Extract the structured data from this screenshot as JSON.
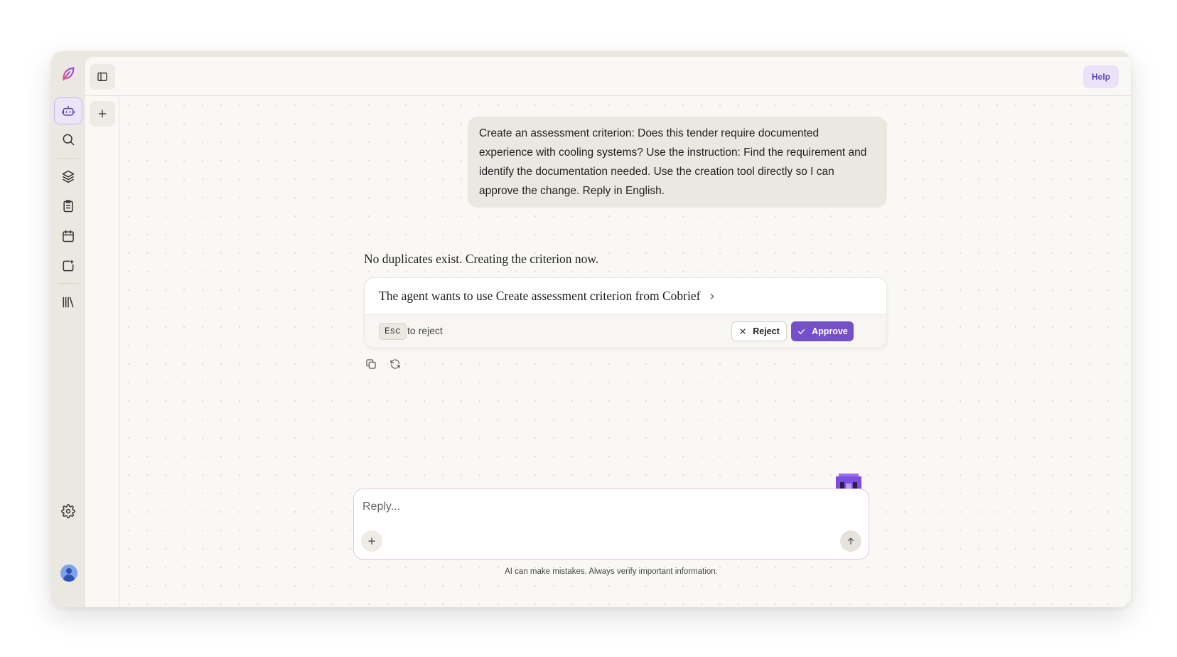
{
  "header": {
    "help_label": "Help"
  },
  "conversation": {
    "user_message": "Create an assessment criterion: Does this tender require documented experience with cooling systems? Use the instruction: Find the requirement and identify the documentation needed. Use the creation tool directly so I can approve the change. Reply in English.",
    "assistant_text": "No duplicates exist. Creating the criterion now.",
    "tool_request": {
      "title": "The agent wants to use Create assessment criterion from Cobrief",
      "shortcut_key": "Esc",
      "shortcut_hint": "to reject",
      "reject_label": "Reject",
      "approve_label": "Approve"
    }
  },
  "composer": {
    "placeholder": "Reply...",
    "disclaimer": "AI can make mistakes. Always verify important information."
  },
  "colors": {
    "accent": "#7451c9",
    "help_bg": "#ebe2fa",
    "active_rail_bg": "#ebe6f7"
  }
}
